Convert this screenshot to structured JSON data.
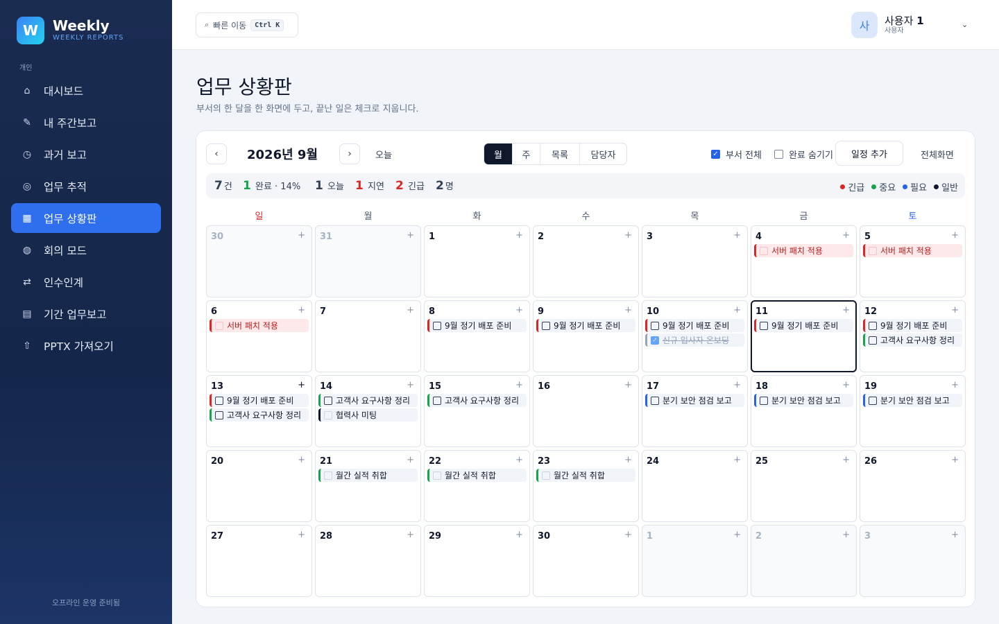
{
  "app": {
    "logo_letter": "W",
    "name": "Weekly",
    "subtitle": "WEEKLY REPORTS"
  },
  "sidebar": {
    "section": "개인",
    "items": [
      {
        "label": "대시보드",
        "icon": "home-icon",
        "glyph": "⌂"
      },
      {
        "label": "내 주간보고",
        "icon": "pencil-icon",
        "glyph": "✎"
      },
      {
        "label": "과거 보고",
        "icon": "clock-icon",
        "glyph": "◷"
      },
      {
        "label": "업무 추적",
        "icon": "target-icon",
        "glyph": "◎"
      },
      {
        "label": "업무 상황판",
        "icon": "grid-icon",
        "glyph": "▦",
        "active": true
      },
      {
        "label": "회의 모드",
        "icon": "globe-icon",
        "glyph": "◍"
      },
      {
        "label": "인수인계",
        "icon": "swap-icon",
        "glyph": "⇄"
      },
      {
        "label": "기간 업무보고",
        "icon": "list-icon",
        "glyph": "▤"
      },
      {
        "label": "PPTX 가져오기",
        "icon": "upload-icon",
        "glyph": "⇧"
      }
    ],
    "footer": "오프라인 운영 준비됨"
  },
  "topbar": {
    "search_placeholder": "빠른 이동",
    "shortcut": "Ctrl K",
    "user": {
      "avatar": "사",
      "name_prefix": "사용자",
      "name_num": "1",
      "role": "사용자"
    }
  },
  "page": {
    "title": "업무 상황판",
    "subtitle": "부서의 한 달을 한 화면에 두고, 끝난 일은 체크로 지웁니다."
  },
  "toolbar": {
    "prev": "‹",
    "next": "›",
    "month": "2026년 9월",
    "today": "오늘",
    "views": [
      {
        "label": "월",
        "active": true
      },
      {
        "label": "주"
      },
      {
        "label": "목록"
      },
      {
        "label": "담당자"
      }
    ],
    "dept_all": "부서 전체",
    "dept_all_checked": true,
    "hide_done": "완료 숨기기",
    "hide_done_checked": false,
    "add": "일정 추가",
    "fullscreen": "전체화면"
  },
  "stats": {
    "total": "7",
    "total_unit": "건",
    "done": "1",
    "done_unit": "완료 · 14%",
    "today": "1",
    "today_unit": "오늘",
    "delayed": "1",
    "delayed_unit": "지연",
    "urgent": "2",
    "urgent_unit": "긴급",
    "people": "2",
    "people_unit": "명",
    "legend": [
      {
        "label": "긴급",
        "color": "#dc2626"
      },
      {
        "label": "중요",
        "color": "#16a34a"
      },
      {
        "label": "필요",
        "color": "#2563eb"
      },
      {
        "label": "일반",
        "color": "#0f172a"
      }
    ]
  },
  "weekdays": [
    {
      "label": "일",
      "color": "#dc2626"
    },
    {
      "label": "월"
    },
    {
      "label": "화"
    },
    {
      "label": "수"
    },
    {
      "label": "목"
    },
    {
      "label": "금"
    },
    {
      "label": "토",
      "color": "#2563eb"
    }
  ],
  "calendar": {
    "weeks": [
      [
        {
          "day": "30",
          "other": true,
          "events": []
        },
        {
          "day": "31",
          "other": true,
          "events": []
        },
        {
          "day": "1",
          "events": []
        },
        {
          "day": "2",
          "events": []
        },
        {
          "day": "3",
          "events": []
        },
        {
          "day": "4",
          "events": [
            {
              "title": "서버 패치 적용",
              "priority": "urgent",
              "style": "urgent-fill"
            }
          ]
        },
        {
          "day": "5",
          "events": [
            {
              "title": "서버 패치 적용",
              "priority": "urgent",
              "style": "urgent-fill"
            }
          ]
        }
      ],
      [
        {
          "day": "6",
          "events": [
            {
              "title": "서버 패치 적용",
              "priority": "urgent",
              "style": "urgent-fill"
            }
          ]
        },
        {
          "day": "7",
          "events": []
        },
        {
          "day": "8",
          "events": [
            {
              "title": "9월 정기 배포 준비",
              "priority": "urgent"
            }
          ]
        },
        {
          "day": "9",
          "events": [
            {
              "title": "9월 정기 배포 준비",
              "priority": "urgent"
            }
          ]
        },
        {
          "day": "10",
          "events": [
            {
              "title": "9월 정기 배포 준비",
              "priority": "urgent"
            },
            {
              "title": "신규 입사자 온보딩",
              "priority": "general",
              "done": true
            }
          ]
        },
        {
          "day": "11",
          "today": true,
          "events": [
            {
              "title": "9월 정기 배포 준비",
              "priority": "urgent"
            }
          ]
        },
        {
          "day": "12",
          "events": [
            {
              "title": "9월 정기 배포 준비",
              "priority": "urgent"
            },
            {
              "title": "고객사 요구사항 정리",
              "priority": "important"
            }
          ]
        }
      ],
      [
        {
          "day": "13",
          "plus_dark": true,
          "events": [
            {
              "title": "9월 정기 배포 준비",
              "priority": "urgent"
            },
            {
              "title": "고객사 요구사항 정리",
              "priority": "important"
            }
          ]
        },
        {
          "day": "14",
          "events": [
            {
              "title": "고객사 요구사항 정리",
              "priority": "important"
            },
            {
              "title": "협력사 미팅",
              "priority": "general",
              "style": "faded"
            }
          ]
        },
        {
          "day": "15",
          "events": [
            {
              "title": "고객사 요구사항 정리",
              "priority": "important"
            }
          ]
        },
        {
          "day": "16",
          "events": []
        },
        {
          "day": "17",
          "events": [
            {
              "title": "분기 보안 점검 보고",
              "priority": "normal"
            }
          ]
        },
        {
          "day": "18",
          "events": [
            {
              "title": "분기 보안 점검 보고",
              "priority": "normal"
            }
          ]
        },
        {
          "day": "19",
          "events": [
            {
              "title": "분기 보안 점검 보고",
              "priority": "normal"
            }
          ]
        }
      ],
      [
        {
          "day": "20",
          "events": []
        },
        {
          "day": "21",
          "events": [
            {
              "title": "월간 실적 취합",
              "priority": "important",
              "style": "faded"
            }
          ]
        },
        {
          "day": "22",
          "events": [
            {
              "title": "월간 실적 취합",
              "priority": "important",
              "style": "faded"
            }
          ]
        },
        {
          "day": "23",
          "events": [
            {
              "title": "월간 실적 취합",
              "priority": "important",
              "style": "faded"
            }
          ]
        },
        {
          "day": "24",
          "events": []
        },
        {
          "day": "25",
          "events": []
        },
        {
          "day": "26",
          "events": []
        }
      ],
      [
        {
          "day": "27",
          "events": []
        },
        {
          "day": "28",
          "events": []
        },
        {
          "day": "29",
          "events": []
        },
        {
          "day": "30",
          "events": []
        },
        {
          "day": "1",
          "other": true,
          "events": []
        },
        {
          "day": "2",
          "other": true,
          "events": []
        },
        {
          "day": "3",
          "other": true,
          "events": []
        }
      ]
    ]
  }
}
